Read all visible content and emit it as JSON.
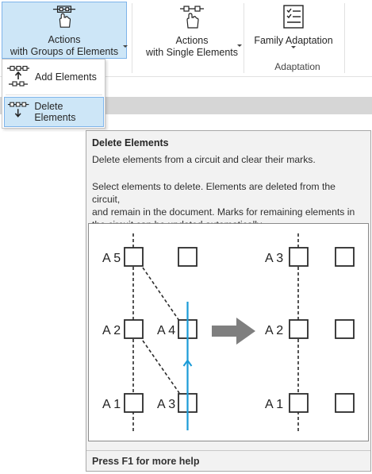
{
  "ribbon": {
    "buttons": [
      {
        "line1": "Actions",
        "line2": "with Groups of Elements",
        "icon": "group-elements-hand-icon"
      },
      {
        "line1": "Actions",
        "line2": "with Single Elements",
        "icon": "single-element-hand-icon"
      },
      {
        "line1": "Family Adaptation",
        "icon": "checklist-icon"
      }
    ],
    "group_label": "Adaptation"
  },
  "dropdown": {
    "items": [
      {
        "label": "Add Elements",
        "icon": "add-elements-icon"
      },
      {
        "label": "Delete Elements",
        "icon": "delete-elements-icon"
      }
    ]
  },
  "tooltip": {
    "title": "Delete Elements",
    "summary": "Delete elements from a circuit and clear their marks.",
    "details": [
      "Select elements to delete. Elements are deleted from the circuit,",
      "and remain in the document. Marks for remaining elements in",
      "the circuit can be updated automatically."
    ],
    "footer": "Press F1 for more help",
    "figure": {
      "before": {
        "labels": [
          "A 5",
          "A 4",
          "A 2",
          "A 1",
          "A 3"
        ]
      },
      "after": {
        "labels": [
          "A 3",
          "A 2",
          "A 1"
        ]
      },
      "colors": {
        "line": "#1a9bd7",
        "arrow": "#7f7f7f",
        "stroke": "#2b2b2b"
      }
    }
  }
}
